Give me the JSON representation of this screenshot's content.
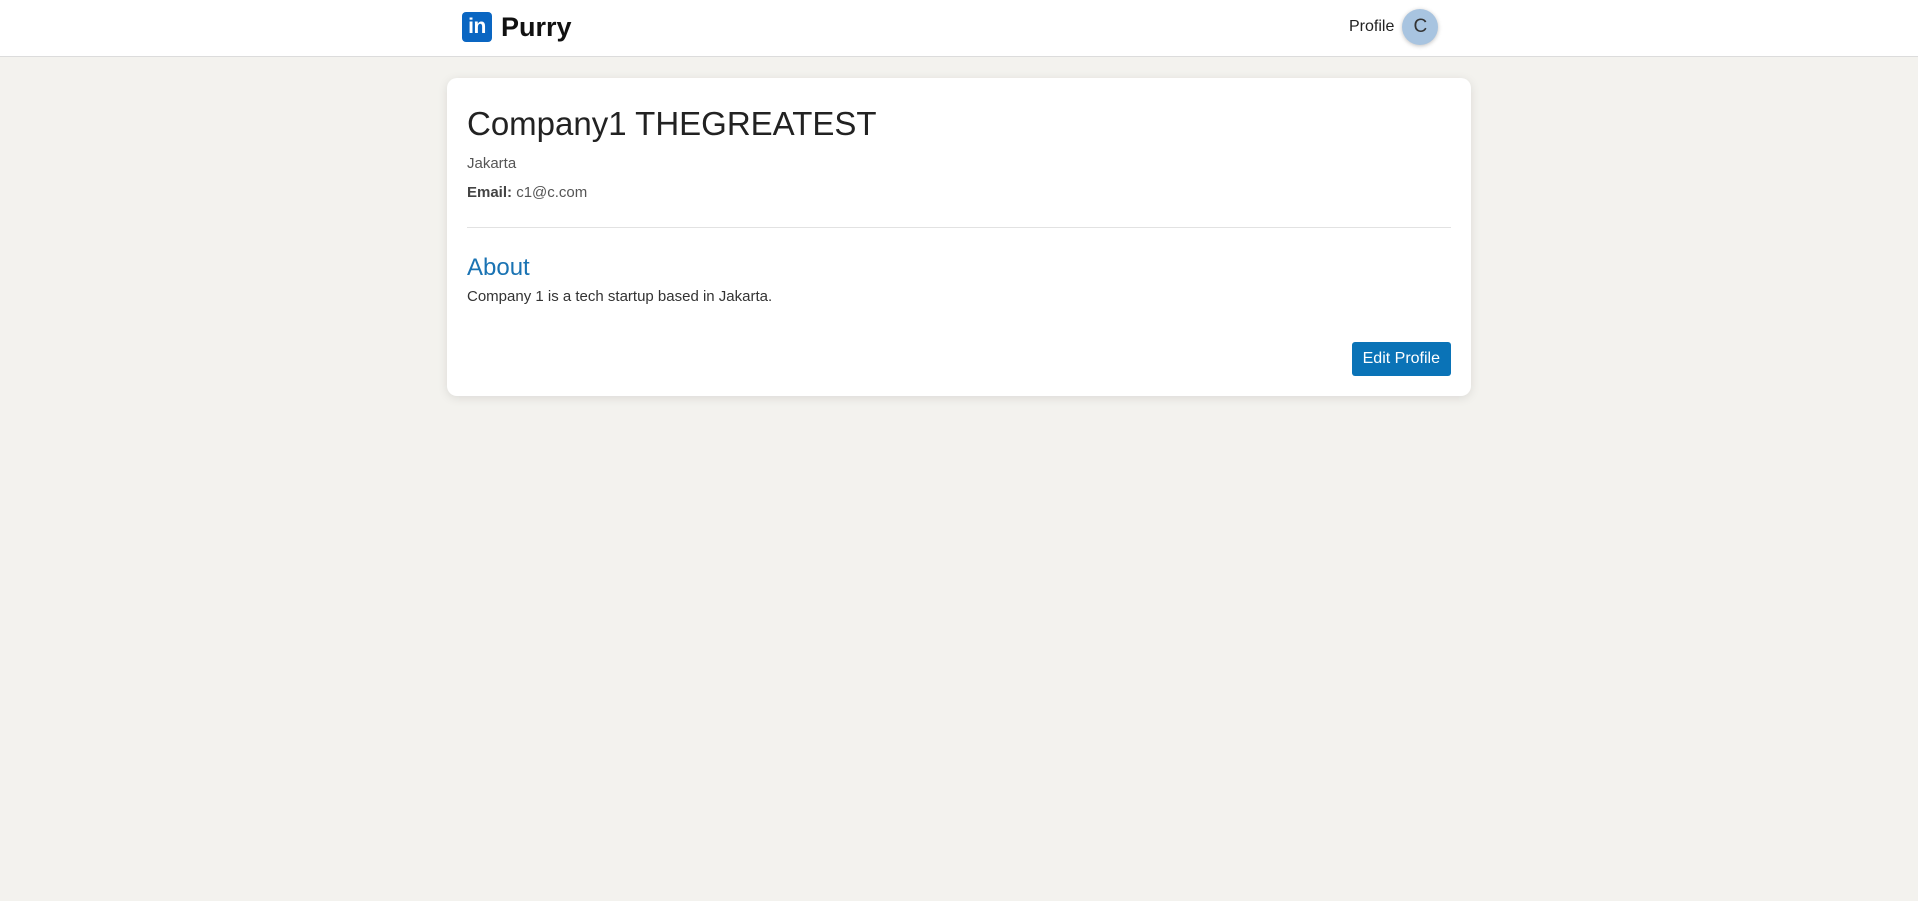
{
  "header": {
    "logo_icon_text": "in",
    "brand_name": "Purry",
    "profile_label": "Profile",
    "avatar_initial": "C"
  },
  "company": {
    "name": "Company1 THEGREATEST",
    "location": "Jakarta",
    "email_label": "Email:",
    "email": "c1@c.com"
  },
  "about": {
    "title": "About",
    "text": "Company 1 is a tech startup based in Jakarta."
  },
  "actions": {
    "edit_profile_label": "Edit Profile"
  },
  "colors": {
    "brand_blue": "#0a66c2",
    "about_title": "#1a73b3",
    "button": "#0a73b7",
    "page_background": "#f3f2ee"
  }
}
